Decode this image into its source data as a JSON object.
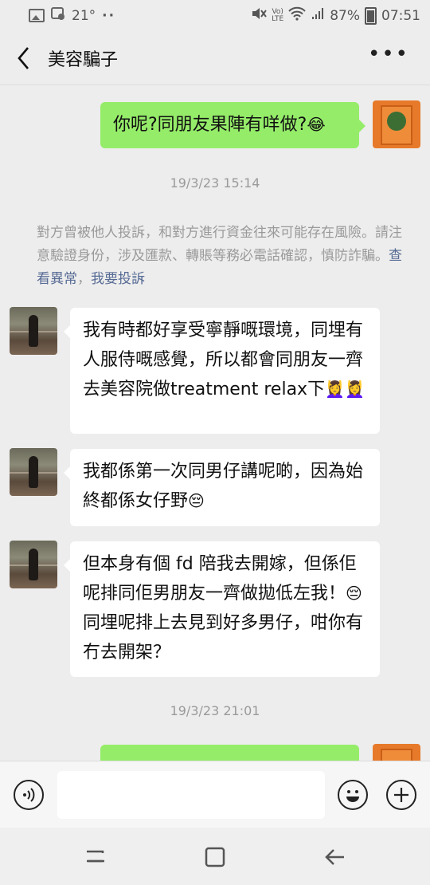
{
  "status_bar": {
    "temperature": "21°",
    "dots": "··",
    "battery": "87%",
    "time": "07:51"
  },
  "header": {
    "title": "美容騙子",
    "more": "•••"
  },
  "messages": {
    "m1": {
      "text": "你呢?同朋友果陣有咩做?",
      "emoji": "😂"
    },
    "t1": "19/3/23 15:14",
    "notice": {
      "text": "對方曾被他人投訴，和對方進行資金往來可能存在風險。請注意驗證身份，涉及匯款、轉賬等務必電話確認，慎防詐騙。",
      "link1": "查看異常",
      "sep": "，",
      "link2": "我要投訴"
    },
    "m2": {
      "text": "我有時都好享受寧靜嘅環境，同埋有人服侍嘅感覺，所以都會同朋友一齊去美容院做treatment relax下",
      "emoji": "💆‍♀️💆‍♀️"
    },
    "m3": {
      "text": "我都係第一次同男仔講呢啲，因為始終都係女仔野",
      "emoji": "😔"
    },
    "m4": {
      "text1": " 但本身有個 fd 陪我去開嫁，但係佢呢排同佢男朋友一齊做拋低左我！",
      "emoji": "😔",
      "text2": "同埋呢排上去見到好多男仔，咁你有冇去開架？"
    },
    "t2": "19/3/23 21:01"
  },
  "input": {
    "placeholder": "",
    "value": ""
  },
  "colors": {
    "bg": "#ededed",
    "outgoing": "#95ec69",
    "incoming": "#ffffff",
    "link": "#576b95"
  }
}
